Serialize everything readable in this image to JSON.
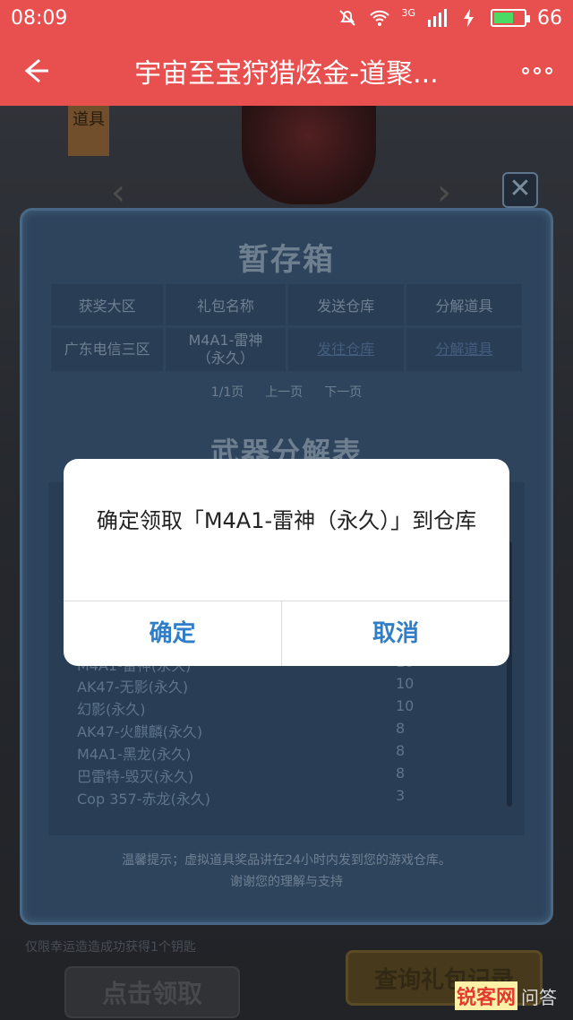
{
  "status_bar": {
    "time": "08:09",
    "network": "3G",
    "battery": "66",
    "battery_level": 0.66
  },
  "nav": {
    "title": "宇宙至宝狩猎炫金-道聚...",
    "back_icon": "back-arrow-icon",
    "more_icon": "more-dots-icon"
  },
  "background": {
    "tag_text": "道具",
    "close_icon": "close-icon"
  },
  "panel": {
    "title": "暂存箱",
    "table": {
      "headers": [
        "获奖大区",
        "礼包名称",
        "发送仓库",
        "分解道具"
      ],
      "rows": [
        {
          "region": "广东电信三区",
          "package": "M4A1-雷神（永久）",
          "send": "发往仓库",
          "decompose": "分解道具"
        }
      ]
    },
    "pager": {
      "page": "1/1页",
      "prev": "上一页",
      "next": "下一页"
    },
    "section_title": "武器分解表",
    "weapons": [
      {
        "name": "M4A1-雷神(永久)",
        "value": "10"
      },
      {
        "name": "AK47-无影(永久)",
        "value": "10"
      },
      {
        "name": "幻影(永久)",
        "value": "10"
      },
      {
        "name": "AK47-火麒麟(永久)",
        "value": "8"
      },
      {
        "name": "M4A1-黑龙(永久)",
        "value": "8"
      },
      {
        "name": "巴雷特-毁灭(永久)",
        "value": "8"
      },
      {
        "name": "Cop 357-赤龙(永久)",
        "value": "3"
      }
    ],
    "tip_line1": "温馨提示；虚拟道具奖品讲在24小时内发到您的游戏仓库。",
    "tip_line2": "谢谢您的理解与支持"
  },
  "bottom": {
    "note": "仅限幸运造造成功获得1个钥匙",
    "claim_button": "点击领取",
    "query_button": "查询礼包记录"
  },
  "dialog": {
    "message": "确定领取「M4A1-雷神（永久）」到仓库",
    "ok": "确定",
    "cancel": "取消"
  },
  "watermark": {
    "brand": "锐客网",
    "sub": "问答"
  }
}
